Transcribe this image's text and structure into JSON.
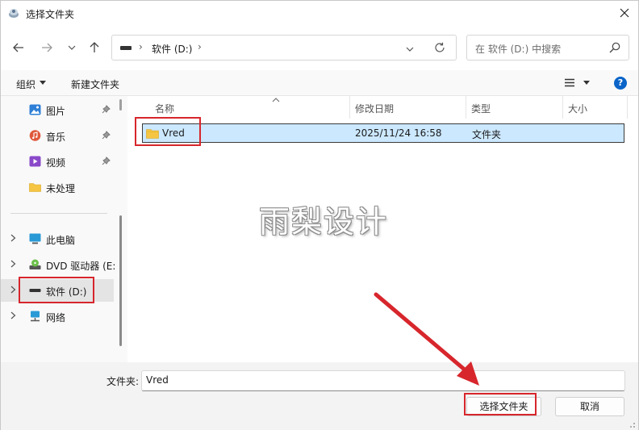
{
  "window": {
    "title": "选择文件夹"
  },
  "nav": {
    "address_segments": [
      "软件 (D:)"
    ],
    "search_placeholder": "在 软件 (D:) 中搜索"
  },
  "toolbar": {
    "organize": "组织",
    "new_folder": "新建文件夹",
    "help": "?"
  },
  "sidebar": {
    "quick": [
      {
        "label": "图片",
        "icon": "pictures-icon",
        "color": "#2f7fd6"
      },
      {
        "label": "音乐",
        "icon": "music-icon",
        "color": "#e0583c"
      },
      {
        "label": "视频",
        "icon": "video-icon",
        "color": "#8a49c9"
      },
      {
        "label": "未处理",
        "icon": "folder-icon",
        "color": "#f5c543"
      }
    ],
    "tree": [
      {
        "label": "此电脑",
        "icon": "computer-icon"
      },
      {
        "label": "DVD 驱动器 (E:",
        "icon": "dvd-drive-icon"
      },
      {
        "label": "软件 (D:)",
        "icon": "drive-icon",
        "selected": true
      },
      {
        "label": "网络",
        "icon": "network-icon"
      }
    ]
  },
  "columns": [
    "名称",
    "修改日期",
    "类型",
    "大小"
  ],
  "files": [
    {
      "name": "Vred",
      "modified": "2025/11/24 16:58",
      "type": "文件夹",
      "size": ""
    }
  ],
  "watermark": "雨梨设计",
  "footer": {
    "folder_label": "文件夹:",
    "folder_value": "Vred",
    "select_button": "选择文件夹",
    "cancel_button": "取消"
  },
  "colors": {
    "highlight": "#d7262c",
    "selection": "#cce8ff",
    "accent": "#0a64c8"
  }
}
